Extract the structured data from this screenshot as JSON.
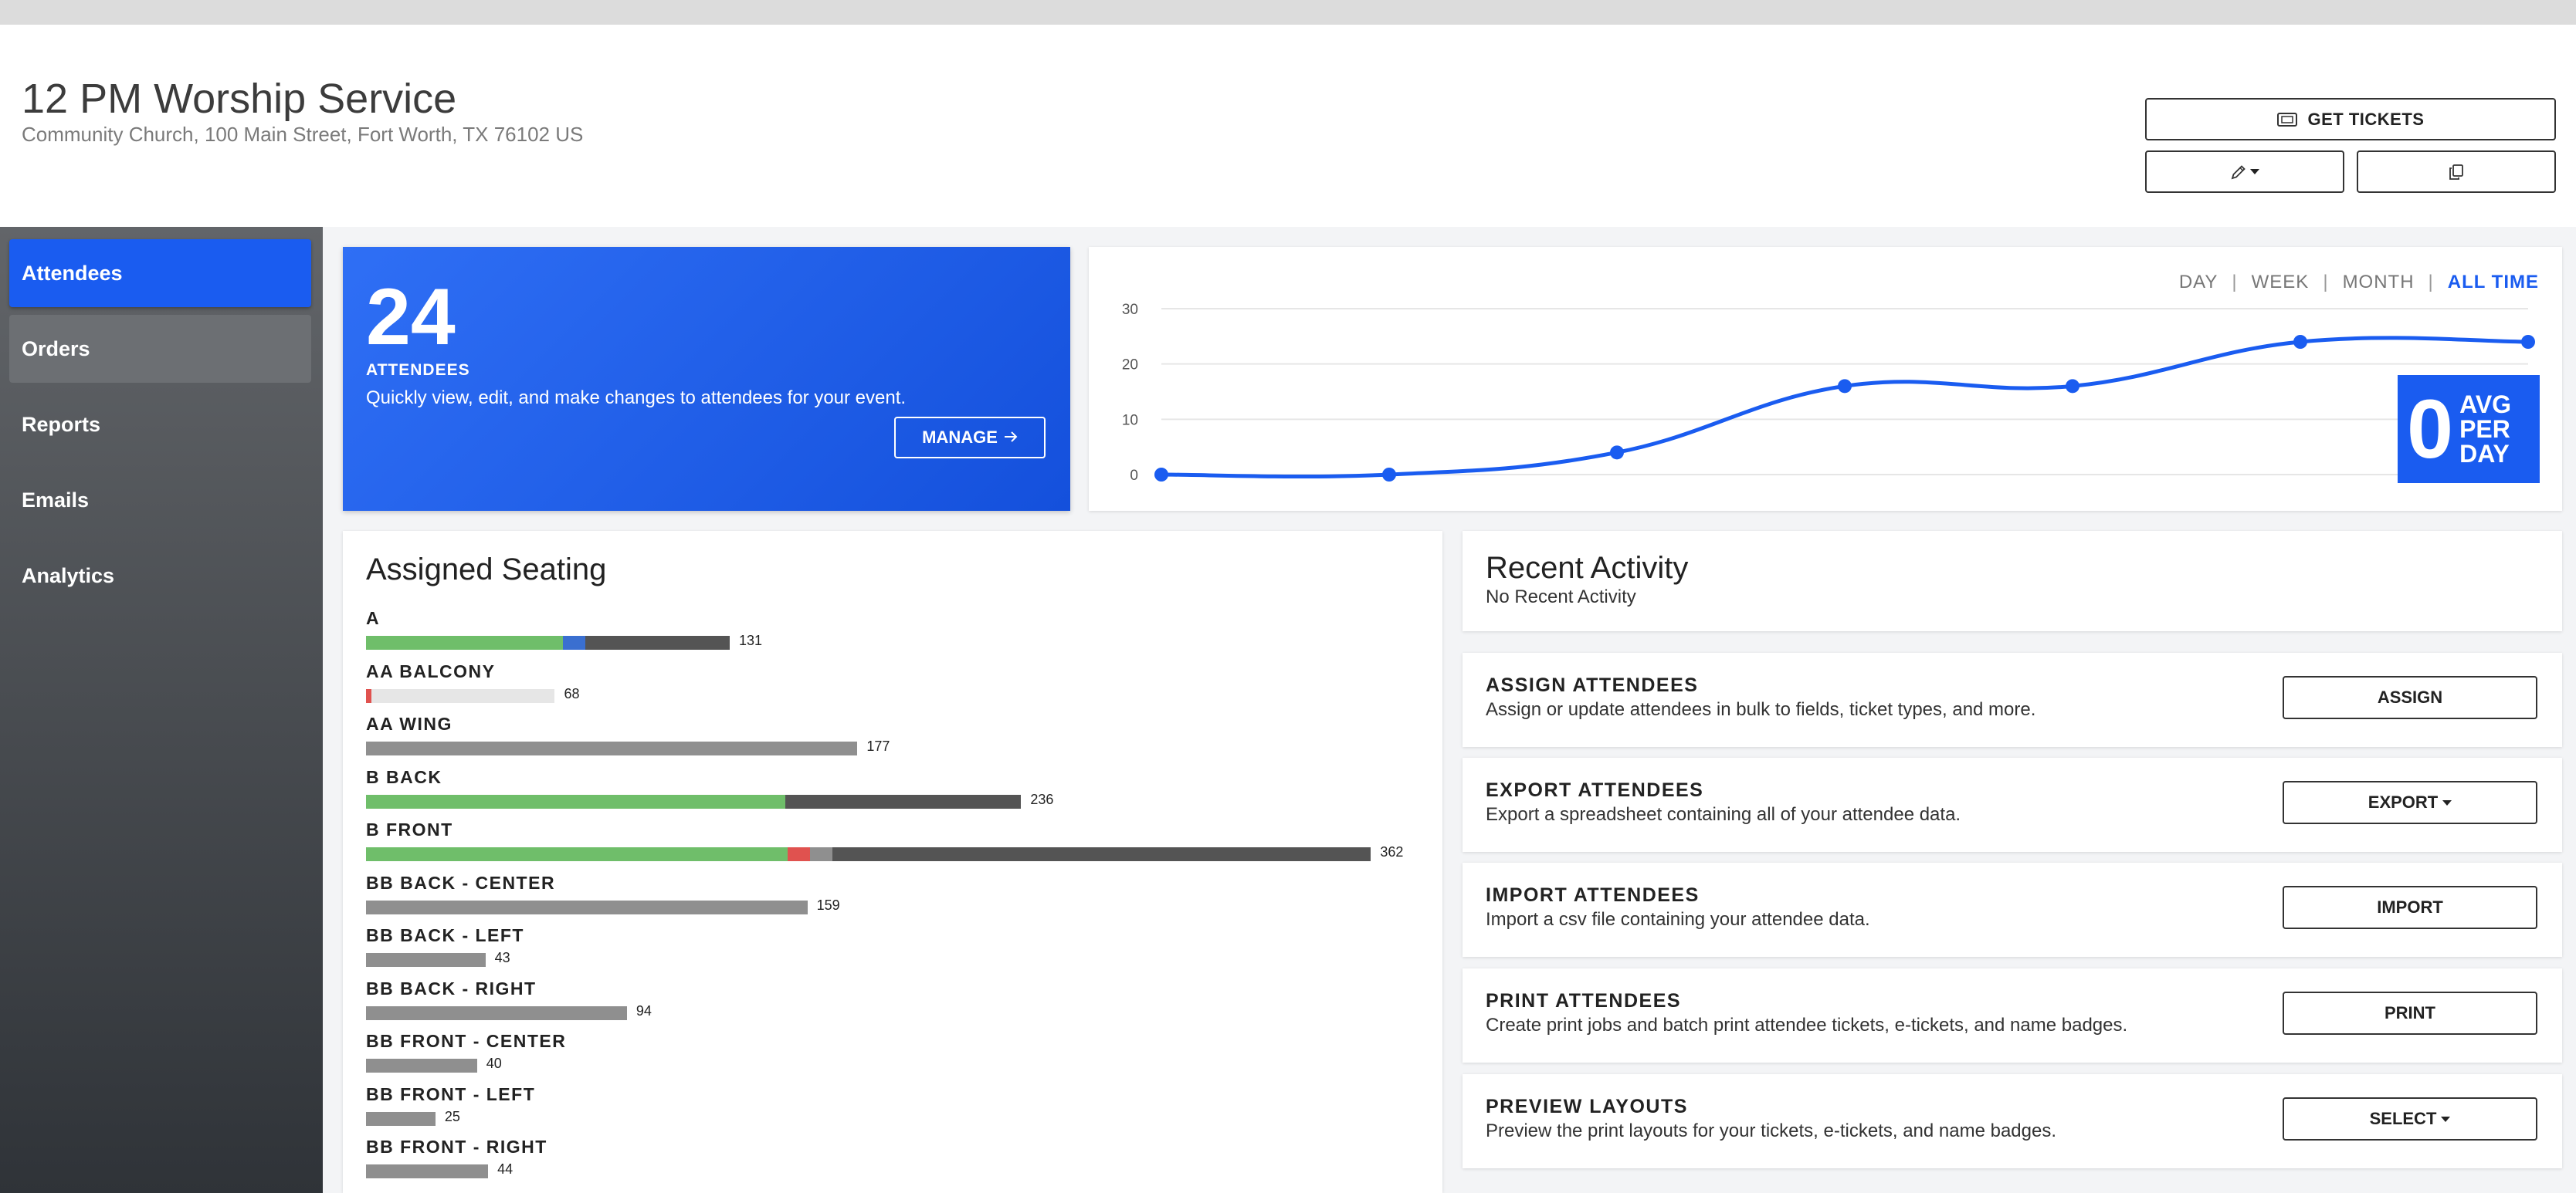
{
  "event": {
    "title": "12 PM Worship Service",
    "address": "Community Church, 100 Main Street, Fort Worth, TX 76102 US"
  },
  "header_buttons": {
    "get_tickets_label": "GET TICKETS",
    "get_tickets_icon": "ticket-icon",
    "edit_icon": "pencil-icon",
    "copy_icon": "copy-icon"
  },
  "sidebar": {
    "items": [
      {
        "label": "Attendees",
        "state": "active"
      },
      {
        "label": "Orders",
        "state": "hover"
      },
      {
        "label": "Reports",
        "state": "normal"
      },
      {
        "label": "Emails",
        "state": "normal"
      },
      {
        "label": "Analytics",
        "state": "normal"
      }
    ]
  },
  "attendees_summary": {
    "count": "24",
    "label": "ATTENDEES",
    "description": "Quickly view, edit, and make changes to attendees for your event.",
    "manage_label": "MANAGE",
    "accent": "#1a5cf0"
  },
  "chart_range_tabs": [
    {
      "label": "DAY",
      "active": false
    },
    {
      "label": "WEEK",
      "active": false
    },
    {
      "label": "MONTH",
      "active": false
    },
    {
      "label": "ALL TIME",
      "active": true
    }
  ],
  "chart_data": {
    "type": "line",
    "x": [
      1,
      2,
      3,
      4,
      5,
      6,
      7
    ],
    "series": [
      {
        "values": [
          0,
          0,
          4,
          16,
          16,
          24,
          24
        ],
        "color": "#1a5cf0"
      }
    ],
    "yticks": [
      0,
      10,
      20,
      30
    ],
    "ylim": [
      0,
      30
    ],
    "grid": true,
    "title": "",
    "xlabel": "",
    "ylabel": ""
  },
  "avg_per_day": {
    "value": "0",
    "words": [
      "AVG",
      "PER",
      "DAY"
    ]
  },
  "assigned_seating": {
    "title": "Assigned Seating",
    "colors": {
      "green": "#6fbe6a",
      "blue": "#3a6fd0",
      "dark": "#545454",
      "gray": "#8f8f8f",
      "light": "#e6e6e6",
      "red": "#e0524f"
    },
    "sections": [
      {
        "name": "A",
        "total": 131,
        "segments": [
          {
            "color": "green",
            "value": 71
          },
          {
            "color": "blue",
            "value": 8
          },
          {
            "color": "dark",
            "value": 52
          }
        ]
      },
      {
        "name": "AA BALCONY",
        "total": 68,
        "segments": [
          {
            "color": "red",
            "value": 2
          },
          {
            "color": "light",
            "value": 66
          }
        ]
      },
      {
        "name": "AA WING",
        "total": 177,
        "segments": [
          {
            "color": "gray",
            "value": 177
          }
        ]
      },
      {
        "name": "B BACK",
        "total": 236,
        "segments": [
          {
            "color": "green",
            "value": 151
          },
          {
            "color": "dark",
            "value": 85
          }
        ]
      },
      {
        "name": "B FRONT",
        "total": 362,
        "segments": [
          {
            "color": "green",
            "value": 152
          },
          {
            "color": "red",
            "value": 8
          },
          {
            "color": "gray",
            "value": 8
          },
          {
            "color": "dark",
            "value": 194
          }
        ]
      },
      {
        "name": "BB BACK - CENTER",
        "total": 159,
        "segments": [
          {
            "color": "gray",
            "value": 159
          }
        ]
      },
      {
        "name": "BB BACK - LEFT",
        "total": 43,
        "segments": [
          {
            "color": "gray",
            "value": 43
          }
        ]
      },
      {
        "name": "BB BACK - RIGHT",
        "total": 94,
        "segments": [
          {
            "color": "gray",
            "value": 94
          }
        ]
      },
      {
        "name": "BB FRONT - CENTER",
        "total": 40,
        "segments": [
          {
            "color": "gray",
            "value": 40
          }
        ]
      },
      {
        "name": "BB FRONT - LEFT",
        "total": 25,
        "segments": [
          {
            "color": "gray",
            "value": 25
          }
        ]
      },
      {
        "name": "BB FRONT - RIGHT",
        "total": 44,
        "segments": [
          {
            "color": "gray",
            "value": 44
          }
        ]
      }
    ]
  },
  "recent_activity": {
    "title": "Recent Activity",
    "subtitle": "No Recent Activity"
  },
  "actions": [
    {
      "key": "assign",
      "title": "ASSIGN ATTENDEES",
      "description": "Assign or update attendees in bulk to fields, ticket types, and more.",
      "button": "ASSIGN",
      "dropdown": false
    },
    {
      "key": "export",
      "title": "EXPORT ATTENDEES",
      "description": "Export a spreadsheet containing all of your attendee data.",
      "button": "EXPORT",
      "dropdown": true
    },
    {
      "key": "import",
      "title": "IMPORT ATTENDEES",
      "description": "Import a csv file containing your attendee data.",
      "button": "IMPORT",
      "dropdown": false
    },
    {
      "key": "print",
      "title": "PRINT ATTENDEES",
      "description": "Create print jobs and batch print attendee tickets, e-tickets, and name badges.",
      "button": "PRINT",
      "dropdown": false
    },
    {
      "key": "preview",
      "title": "PREVIEW LAYOUTS",
      "description": "Preview the print layouts for your tickets, e-tickets, and name badges.",
      "button": "SELECT",
      "dropdown": true
    }
  ]
}
